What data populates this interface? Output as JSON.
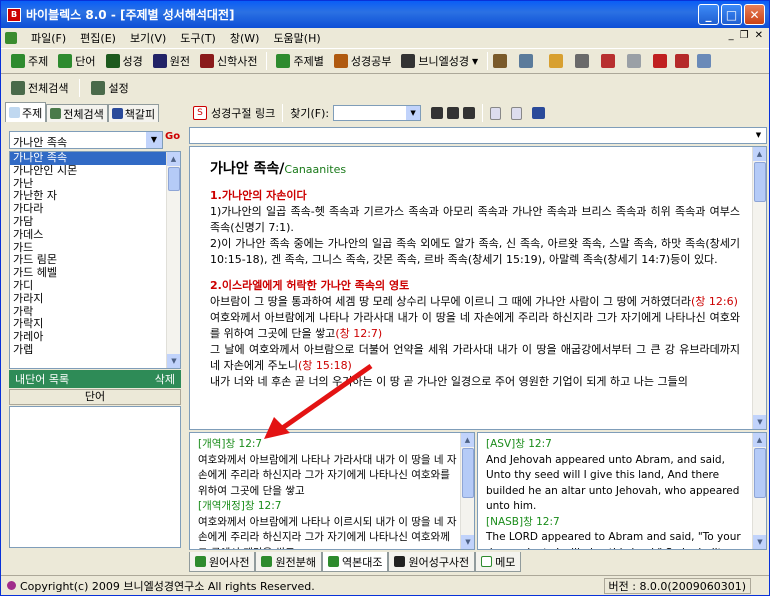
{
  "window": {
    "title": "바이블렉스 8.0 - [주제별 성서해석대전]"
  },
  "menu": [
    "파일(F)",
    "편집(E)",
    "보기(V)",
    "도구(T)",
    "창(W)",
    "도움말(H)"
  ],
  "toolbar1": [
    {
      "label": "주제",
      "icon": "theme-icon",
      "color": "#2e8b2e"
    },
    {
      "label": "단어",
      "icon": "word-icon",
      "color": "#2e8b2e"
    },
    {
      "label": "성경",
      "icon": "bible-icon",
      "color": "#1d5a1d"
    },
    {
      "label": "원전",
      "icon": "original-icon",
      "color": "#222266"
    },
    {
      "label": "신학사전",
      "icon": "dictionary-icon",
      "color": "#8a1a1a"
    },
    {
      "label": "주제별",
      "icon": "topic-icon",
      "color": "#2e8b2e"
    },
    {
      "label": "성경공부",
      "icon": "study-icon",
      "color": "#b05a10"
    },
    {
      "label": "브니엘성경",
      "icon": "peniel-icon",
      "color": "#333333"
    }
  ],
  "toolbar2": [
    {
      "label": "전체검색",
      "icon": "search-all-icon"
    },
    {
      "label": "설정",
      "icon": "settings-icon"
    }
  ],
  "left": {
    "tabs": [
      "주제",
      "전체검색",
      "책갈피"
    ],
    "combo_value": "가나안 족속",
    "list": [
      "가나안 족속",
      "가나안인 시몬",
      "가난",
      "가난한 자",
      "가다라",
      "가담",
      "가데스",
      "가드",
      "가드 림몬",
      "가드 헤벨",
      "가디",
      "가라지",
      "가락",
      "가락지",
      "가레아",
      "가렙"
    ],
    "my_words_label": "내단어 목록",
    "delete_label": "삭제",
    "word_header": "단어"
  },
  "right_toolbar": {
    "link_label": "성경구절 링크",
    "find_label": "찾기(F):"
  },
  "content": {
    "title": "가나안 족속",
    "title_en": "Canaanites",
    "section1": "1.가나안의 자손이다",
    "p1": "1)가나안의 일곱 족속-헷 족속과 기르가스 족속과 아모리 족속과 가나안 족속과 브리스 족속과 히위 족속과 여부스 족속(신명기 7:1).",
    "p2": "2)이 가나안 족속 중에는 가나안의 일곱 족속 외에도 알가 족속, 신 족속, 아르왓 족속, 스말 족속, 하맛 족속(창세기 10:15-18), 겐 족속, 그니스 족속, 갓몬 족속, 르바 족속(창세기 15:19), 아말렉 족속(창세기 14:7)등이 있다.",
    "section2": "2.이스라엘에게 허락한 가나안 족속의 영토",
    "p3a": "아브람이 그 땅을 통과하여 세겜 땅 모레 상수리 나무에 이르니 그 때에 가나안 사람이 그 땅에 거하였더라",
    "p3ref": "(창 12:6)",
    "p4a": "여호와께서 아브람에게 나타나 가라사대 내가 이 땅을 네 자손에게 주리라 하신지라 그가 자기에게 나타나신 여호와를 위하여 그곳에 단을 쌓고",
    "p4ref": "(창 12:7)",
    "p5a": "그 날에 여호와께서 아브람으로 더불어 언약을 세워 가라사대 내가 이 땅을 애굽강에서부터 그 큰 강 유브라데까지 네 자손에게 주노니",
    "p5ref": "(창 15:18)",
    "p6": "내가 너와 네 후손 곧 너의 우거하는 이 땅 곧 가나안 일경으로 주어 영원한 기업이 되게 하고 나는 그들의"
  },
  "compare_left": {
    "v1h": "[개역]창 12:7",
    "v1": "여호와께서 아브람에게 나타나 가라사대 내가 이 땅을 네 자손에게 주리라 하신지라 그가 자기에게 나타나신 여호와를 위하여 그곳에 단을 쌓고",
    "v2h": "[개역개정]창 12:7",
    "v2": "여호와께서 아브람에게 나타나 이르시되 내가 이 땅을 네 자손에게 주리라 하신지라 그가 자기에게 나타나신 여호와께 그 곳에서 제단을 쌓고"
  },
  "compare_right": {
    "v1h": "[ASV]창 12:7",
    "v1": "And Jehovah appeared unto Abram, and said, Unto thy seed will I give this land, And there builded he an altar unto Jehovah, who appeared unto him.",
    "v2h": "[NASB]창 12:7",
    "v2": "The LORD appeared to Abram and said, \"To your descendants I will give this land,\" So he built an altar there to the LORD who had appeared to him."
  },
  "bottom_tabs": [
    "원어사전",
    "원전분해",
    "역본대조",
    "원어성구사전",
    "메모"
  ],
  "status": {
    "copyright": "Copyright(c) 2009 브니엘성경연구소 All rights Reserved.",
    "version": "버전 : 8.0.0(2009060301)"
  }
}
